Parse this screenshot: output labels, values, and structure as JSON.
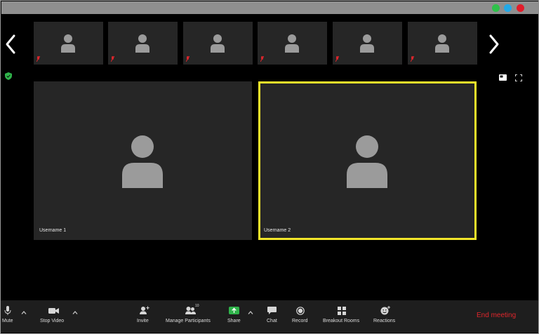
{
  "window": {
    "controls": [
      {
        "name": "maximize",
        "color": "#2fc14a"
      },
      {
        "name": "minimize",
        "color": "#23a9e8"
      },
      {
        "name": "close",
        "color": "#e31c2a"
      }
    ]
  },
  "gallery": {
    "thumbnail_count": 6,
    "muted_icon": "mic-muted-icon",
    "avatar_icon": "person-icon"
  },
  "tiles": [
    {
      "username": "Username 1",
      "active_speaker": false
    },
    {
      "username": "Username 2",
      "active_speaker": true
    }
  ],
  "colors": {
    "active_speaker_border": "#f2e62a",
    "end_meeting": "#e0262c",
    "share_icon": "#2fb34a",
    "muted_mic": "#d8262c"
  },
  "toolbar": {
    "mute": "Mute",
    "stop_video": "Stop Video",
    "invite": "Invite",
    "manage_participants": "Manage Participants",
    "participant_count": "10",
    "share": "Share",
    "chat": "Chat",
    "record": "Record",
    "breakout_rooms": "Breakout Rooms",
    "reactions": "Reactions",
    "end_meeting": "End meeting"
  }
}
